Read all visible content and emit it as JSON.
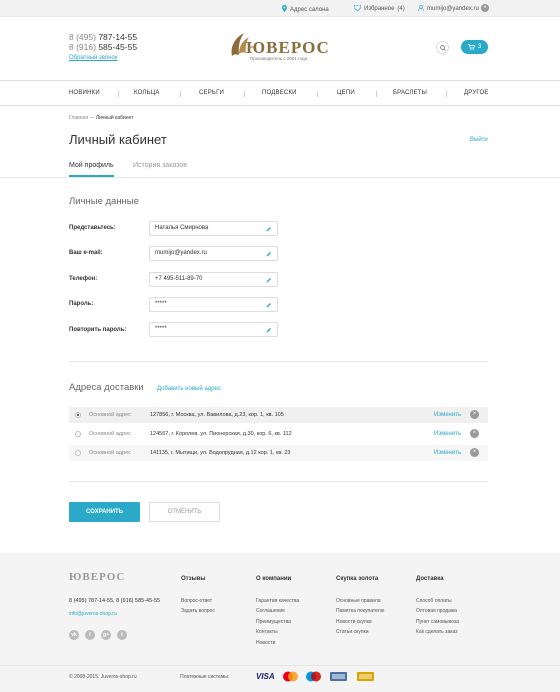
{
  "topbar": {
    "salon": "Адрес салона",
    "favorites": "Избранное",
    "favorites_count": "(4)",
    "user_email": "mumijo@yandex.ru",
    "close": "×"
  },
  "header": {
    "phone1_pre": "8 (495)",
    "phone1": "787-14-55",
    "phone2_pre": "8 (916)",
    "phone2": "585-45-55",
    "callback": "Обратный звонок",
    "logo_text": "ЮВЕРОС",
    "logo_sub": "Производитель с 2001 года",
    "cart_count": "3"
  },
  "nav": [
    "НОВИНКИ",
    "КОЛЬЦА",
    "СЕРЬГИ",
    "ПОДВЕСКИ",
    "ЦЕПИ",
    "БРАСЛЕТЫ",
    "ДРУГОЕ"
  ],
  "breadcrumb": {
    "home": "Главная",
    "sep": "—",
    "current": "Личный кабинет"
  },
  "page": {
    "title": "Личный кабинет",
    "logout": "Выйти"
  },
  "tabs": {
    "profile": "Мой профиль",
    "orders": "История заказов"
  },
  "personal": {
    "title": "Личные данные",
    "fields": [
      {
        "label": "Представьтесь:",
        "value": "Наталья Смирнова"
      },
      {
        "label": "Ваш e-mail:",
        "value": "mumijo@yandex.ru"
      },
      {
        "label": "Телефон:",
        "value": "+7 495-511-89-70"
      },
      {
        "label": "Пароль:",
        "value": "*****"
      },
      {
        "label": "Повторить пароль:",
        "value": "*****"
      }
    ]
  },
  "delivery": {
    "title": "Адреса доставки",
    "add": "Добавить новый адрес",
    "edit_label": "Изменить",
    "addresses": [
      {
        "type": "Основной адрес",
        "text": "127856, г. Москва, ул. Вавилова, д.23, кор. 1, кв. 105",
        "selected": true
      },
      {
        "type": "Основной адрес",
        "text": "124567, г. Королев, ул. Пионерская, д.30, кор. 6, кв. 112",
        "selected": false
      },
      {
        "type": "Основной адрес",
        "text": "141135, г. Мытищи, ул. Водопрудная, д.12 кор. 1, кв. 23",
        "selected": false
      }
    ]
  },
  "buttons": {
    "save": "СОХРАНИТЬ",
    "cancel": "ОТМЕНИТЬ"
  },
  "footer": {
    "logo": "ЮВЕРОС",
    "phones": "8 (495) 787-14-55, 8 (916) 585-45-55",
    "email": "info@juveros-shop.ru",
    "socials": [
      "vk",
      "f",
      "g+",
      "t"
    ],
    "cols": [
      {
        "title": "Отзывы",
        "links": [
          "Вопрос-ответ",
          "Задать вопрос"
        ]
      },
      {
        "title": "О компании",
        "links": [
          "Гарантия качества",
          "Соглашение",
          "Преимущества",
          "Контакты",
          "Новости"
        ]
      },
      {
        "title": "Скупка золота",
        "links": [
          "Основные правила",
          "Памятка покупателю",
          "Новости скупки",
          "Статьи скупки"
        ]
      },
      {
        "title": "Доставка",
        "links": [
          "Способ оплаты",
          "Оптовая продажа",
          "Пункт самовывоза",
          "Как сделать заказ"
        ]
      }
    ],
    "copyright": "© 2008-2015. Juveros-shop.ru",
    "payment_label": "Платежные системы:",
    "visa": "VISA"
  },
  "colors": {
    "accent": "#2aa9c9",
    "gold": "#8a6d3b"
  }
}
